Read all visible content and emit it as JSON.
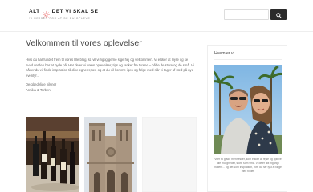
{
  "header": {
    "logo_left": "ALT",
    "logo_right": "DET VI SKAL SE",
    "logo_tagline": "VI REJSER FOR AT SE DU OPLEVE",
    "search_placeholder": ""
  },
  "main": {
    "title": "Velkommen til vores oplevelser",
    "intro": "Hvis du har fundet frem til vores lille blog, så vil vi rigtig gerne sige hej og velkommen. Vi elsker at rejse og se hvad verden har at byde på. Her deler vi vores oplevelser, tips og tanker fra turene – både de store og de små. Vi håber du vil finde inspiration til dine egne rejser, og at du vil komme igen og følge med når vi tager af sted på nye eventyr...",
    "signoff_line1": "De glædelige hilsner",
    "signoff_line2": "Annika & Torben"
  },
  "sidebar": {
    "title": "Hvem er vi.",
    "caption": "Vi er to glade mennesker, som elsker at rejse og opleve alle muligheder, store som små. Vi deler lidt ingang i hullere... og det som inspiration, hvis du har lyst at følge med til det."
  },
  "colors": {
    "header_bg": "#ffffff",
    "button_bg": "#2b2b2b",
    "accent": "#e85d5d"
  }
}
